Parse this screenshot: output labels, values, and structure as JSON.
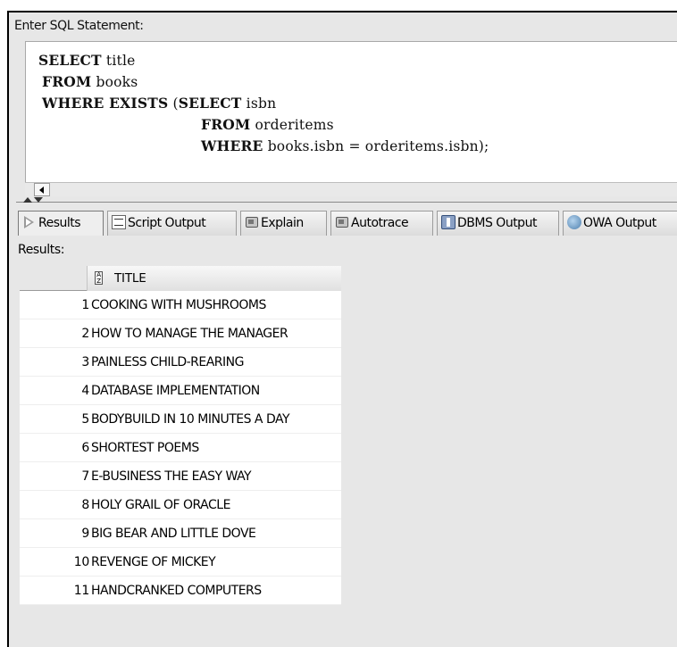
{
  "editor": {
    "label": "Enter SQL Statement:",
    "lines": [
      {
        "keywords": "SELECT",
        "text": " title"
      },
      {
        "keywords": "FROM",
        "text": " books"
      },
      {
        "keywords": "WHERE EXISTS",
        "text": " (",
        "keywords2": "SELECT",
        "text2": " isbn"
      },
      {
        "keywords": "FROM",
        "text": " orderitems"
      },
      {
        "keywords": "WHERE",
        "text": " books.isbn = orderitems.isbn);"
      }
    ]
  },
  "tabs": [
    {
      "label": "Results",
      "icon": "play-icon"
    },
    {
      "label": "Script Output",
      "icon": "script-icon"
    },
    {
      "label": "Explain",
      "icon": "explain-icon"
    },
    {
      "label": "Autotrace",
      "icon": "autotrace-icon"
    },
    {
      "label": "DBMS Output",
      "icon": "dbms-output-icon"
    },
    {
      "label": "OWA Output",
      "icon": "owa-output-icon"
    }
  ],
  "results": {
    "label": "Results:",
    "column_header": "TITLE",
    "rows": [
      {
        "num": "1",
        "title": "COOKING WITH MUSHROOMS"
      },
      {
        "num": "2",
        "title": "HOW TO MANAGE THE MANAGER"
      },
      {
        "num": "3",
        "title": "PAINLESS CHILD-REARING"
      },
      {
        "num": "4",
        "title": "DATABASE IMPLEMENTATION"
      },
      {
        "num": "5",
        "title": "BODYBUILD IN 10 MINUTES A DAY"
      },
      {
        "num": "6",
        "title": "SHORTEST POEMS"
      },
      {
        "num": "7",
        "title": "E-BUSINESS THE EASY WAY"
      },
      {
        "num": "8",
        "title": "HOLY GRAIL OF ORACLE"
      },
      {
        "num": "9",
        "title": "BIG BEAR AND LITTLE DOVE"
      },
      {
        "num": "10",
        "title": "REVENGE OF MICKEY"
      },
      {
        "num": "11",
        "title": "HANDCRANKED COMPUTERS"
      }
    ]
  }
}
